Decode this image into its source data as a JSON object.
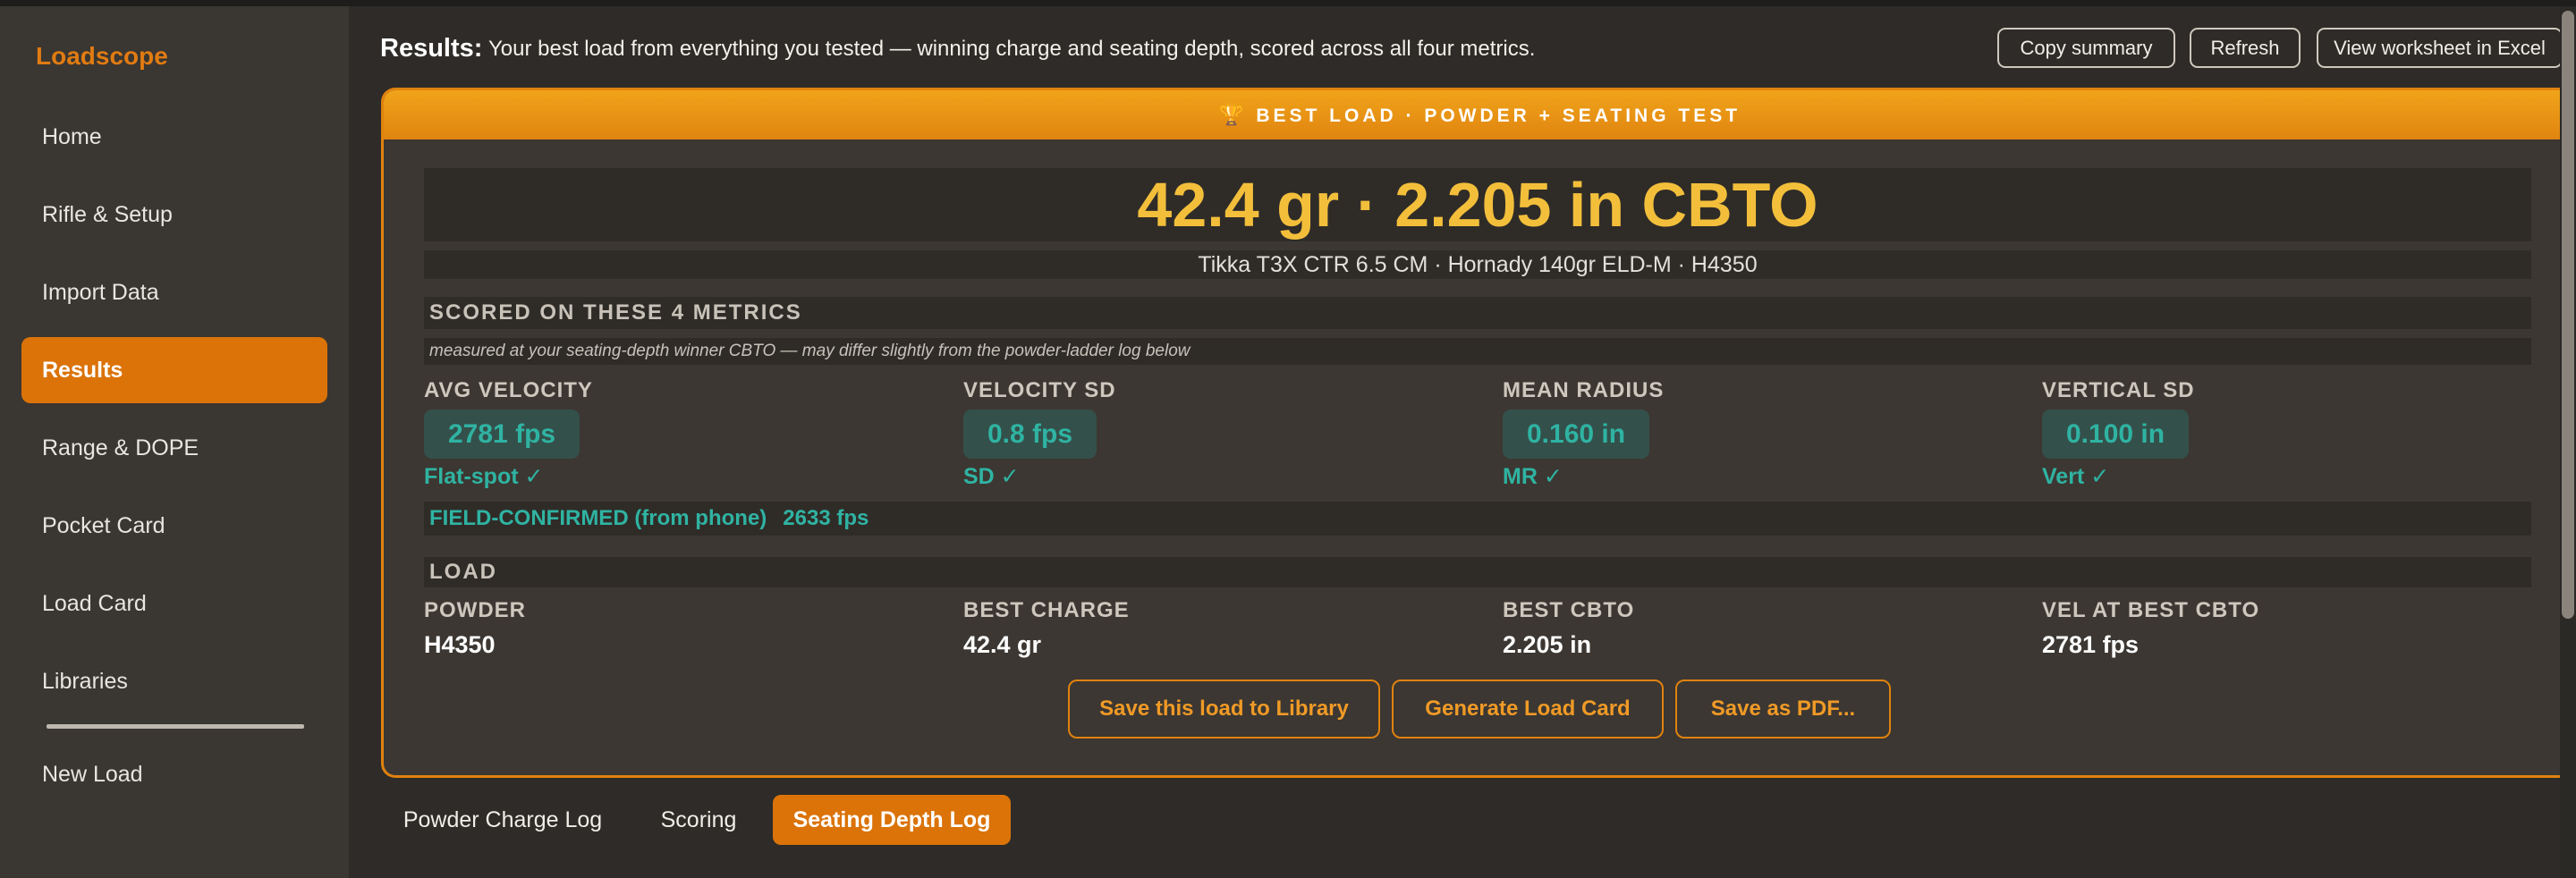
{
  "app": {
    "brand": "Loadscope",
    "nav": [
      {
        "label": "Home"
      },
      {
        "label": "Rifle & Setup"
      },
      {
        "label": "Import Data"
      },
      {
        "label": "Results",
        "active": true
      },
      {
        "label": "Range & DOPE"
      },
      {
        "label": "Pocket Card"
      },
      {
        "label": "Load Card"
      },
      {
        "label": "Libraries"
      },
      {
        "label": "New Load"
      }
    ]
  },
  "header": {
    "title": "Results:",
    "description": "Your best load from everything you tested — winning charge and seating depth, scored across all four metrics.",
    "buttons": {
      "copy": "Copy summary",
      "refresh": "Refresh",
      "excel": "View worksheet in Excel"
    }
  },
  "card": {
    "banner": "BEST LOAD  ·  POWDER + SEATING TEST",
    "trophy_icon": "trophy-icon",
    "hero": "42.4 gr  ·  2.205 in CBTO",
    "subtitle": "Tikka T3X CTR 6.5 CM  ·  Hornady 140gr ELD-M  ·  H4350",
    "metrics_section": "SCORED ON THESE 4 METRICS",
    "metrics_note": "measured at your seating-depth winner CBTO — may differ slightly from the powder-ladder log below",
    "metrics": [
      {
        "label": "AVG VELOCITY",
        "value": "2781 fps",
        "tag": "Flat-spot ✓"
      },
      {
        "label": "VELOCITY SD",
        "value": "0.8 fps",
        "tag": "SD ✓"
      },
      {
        "label": "MEAN RADIUS",
        "value": "0.160 in",
        "tag": "MR ✓"
      },
      {
        "label": "VERTICAL SD",
        "value": "0.100 in",
        "tag": "Vert ✓"
      }
    ],
    "field_confirmed": {
      "label": "FIELD-CONFIRMED (from phone)",
      "value": "2633 fps"
    },
    "load_section": "LOAD",
    "load": [
      {
        "label": "POWDER",
        "value": "H4350"
      },
      {
        "label": "BEST CHARGE",
        "value": "42.4 gr"
      },
      {
        "label": "BEST CBTO",
        "value": "2.205 in"
      },
      {
        "label": "VEL AT BEST CBTO",
        "value": "2781 fps"
      }
    ],
    "actions": {
      "save_library": "Save this load to Library",
      "generate_card": "Generate Load Card",
      "save_pdf": "Save as PDF..."
    }
  },
  "tabs": [
    {
      "label": "Powder Charge Log"
    },
    {
      "label": "Scoring"
    },
    {
      "label": "Seating Depth Log",
      "active": true
    }
  ],
  "colors": {
    "accent": "#db7309",
    "hero": "#f3bf3b",
    "metric": "#2fb3a2",
    "background": "#2e2b28",
    "sidebar": "#3a3631"
  }
}
